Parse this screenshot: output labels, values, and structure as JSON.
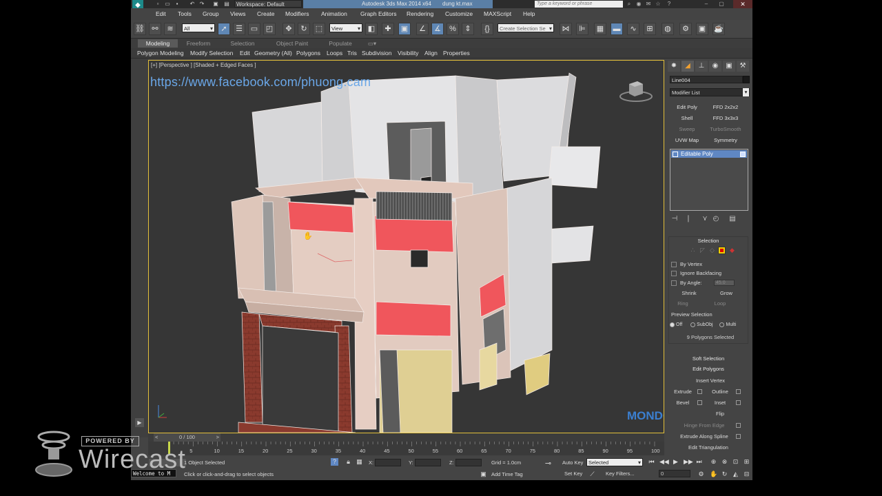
{
  "titlebar": {
    "workspace": "Workspace: Default",
    "app_title": "Autodesk 3ds Max  2014 x64",
    "file_name": "dung kt.max",
    "search_placeholder": "Type a keyword or phrase"
  },
  "menu": [
    "Edit",
    "Tools",
    "Group",
    "Views",
    "Create",
    "Modifiers",
    "Animation",
    "Graph Editors",
    "Rendering",
    "Customize",
    "MAXScript",
    "Help"
  ],
  "toolbar": {
    "filter_value": "All",
    "refcoord_value": "View",
    "named_selection_placeholder": "Create Selection Se"
  },
  "ribbon": {
    "tabs": [
      "Modeling",
      "Freeform",
      "Selection",
      "Object Paint",
      "Populate"
    ],
    "items": [
      "Polygon Modeling",
      "Modify Selection",
      "Edit",
      "Geometry (All)",
      "Polygons",
      "Loops",
      "Tris",
      "Subdivision",
      "Visibility",
      "Align",
      "Properties"
    ]
  },
  "viewport": {
    "label": "[+] [Perspective ] [Shaded + Edged Faces ]",
    "overlay_url": "https://www.facebook.com/phuong.cam",
    "watermark": "MONDO.COM",
    "accent": "#e5c13a"
  },
  "command_panel": {
    "object_name": "Line004",
    "modifier_list": "Modifier List",
    "modifier_buttons": [
      {
        "label": "Edit Poly",
        "dim": false
      },
      {
        "label": "FFD 2x2x2",
        "dim": false
      },
      {
        "label": "Shell",
        "dim": false
      },
      {
        "label": "FFD 3x3x3",
        "dim": false
      },
      {
        "label": "Sweep",
        "dim": true
      },
      {
        "label": "TurboSmooth",
        "dim": true
      },
      {
        "label": "UVW Map",
        "dim": false
      },
      {
        "label": "Symmetry",
        "dim": false
      }
    ],
    "stack_item": "Editable Poly",
    "selection": {
      "title": "Selection",
      "by_vertex": "By Vertex",
      "ignore_backfacing": "Ignore Backfacing",
      "by_angle": "By Angle:",
      "by_angle_value": "45.0",
      "shrink": "Shrink",
      "grow": "Grow",
      "ring": "Ring",
      "loop": "Loop",
      "preview_selection": "Preview Selection",
      "off": "Off",
      "subobj": "SubObj",
      "multi": "Multi",
      "info": "9 Polygons Selected"
    },
    "soft_selection": "Soft Selection",
    "edit_polygons": "Edit Polygons",
    "insert_vertex": "Insert Vertex",
    "extrude": "Extrude",
    "outline": "Outline",
    "bevel": "Bevel",
    "inset": "Inset",
    "flip": "Flip",
    "hinge_from_edge": "Hinge From Edge",
    "extrude_along_spline": "Extrude Along Spline",
    "edit_triangulation": "Edit Triangulation"
  },
  "timeline": {
    "frame_display": "0 / 100",
    "ticks": [
      "5",
      "10",
      "15",
      "20",
      "25",
      "30",
      "35",
      "40",
      "45",
      "50",
      "55",
      "60",
      "65",
      "70",
      "75",
      "80",
      "85",
      "90",
      "95",
      "100"
    ],
    "current_frame": 0,
    "frame_count": 100
  },
  "status": {
    "objects_selected": "1 Object Selected",
    "prompt": "Click or click-and-drag to select objects",
    "x_label": "X:",
    "y_label": "Y:",
    "z_label": "Z:",
    "grid": "Grid = 1.0cm",
    "add_time_tag": "Add Time Tag",
    "auto_key": "Auto Key",
    "selected_value": "Selected",
    "set_key": "Set Key",
    "key_filters": "Key Filters...",
    "frame_field": "0"
  },
  "overlay": {
    "powered_by": "POWERED BY",
    "wirecast": "Wirecast",
    "welcome": "Welcome to M"
  }
}
